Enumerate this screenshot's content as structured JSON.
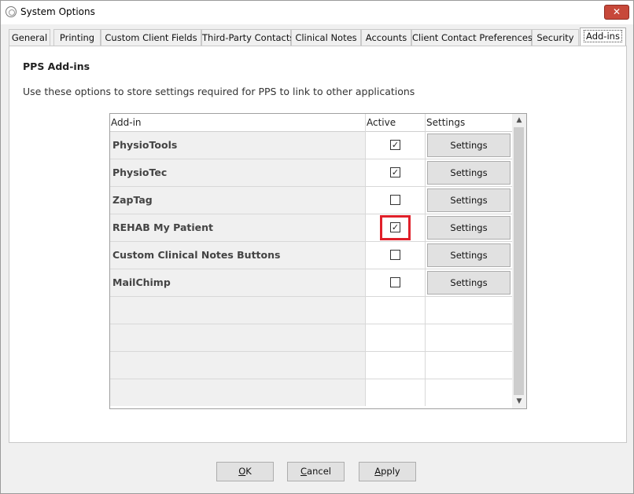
{
  "window": {
    "title": "System Options",
    "close_label": "✕"
  },
  "tabs": [
    {
      "label": "General"
    },
    {
      "label": "Printing"
    },
    {
      "label": "Custom Client Fields"
    },
    {
      "label": "Third-Party Contacts"
    },
    {
      "label": "Clinical Notes"
    },
    {
      "label": "Accounts"
    },
    {
      "label": "Client Contact Preferences"
    },
    {
      "label": "Security"
    },
    {
      "label": "Add-ins",
      "selected": true
    }
  ],
  "section": {
    "title": "PPS Add-ins",
    "description": "Use these options to store settings required for PPS to link to other applications"
  },
  "grid": {
    "columns": [
      "Add-in",
      "Active",
      "Settings"
    ],
    "rows": [
      {
        "name": "PhysioTools",
        "active": true,
        "active_mark": "✓",
        "settings_label": "Settings"
      },
      {
        "name": "PhysioTec",
        "active": true,
        "active_mark": "✓",
        "settings_label": "Settings"
      },
      {
        "name": "ZapTag",
        "active": false,
        "active_mark": "",
        "settings_label": "Settings"
      },
      {
        "name": "REHAB My Patient",
        "active": true,
        "active_mark": "✓",
        "settings_label": "Settings",
        "highlighted": true
      },
      {
        "name": "Custom Clinical Notes Buttons",
        "active": false,
        "active_mark": "",
        "settings_label": "Settings"
      },
      {
        "name": "MailChimp",
        "active": false,
        "active_mark": "",
        "settings_label": "Settings"
      }
    ],
    "scroll_up": "▲",
    "scroll_down": "▼"
  },
  "footer": {
    "ok": {
      "mnemonic": "O",
      "rest": "K"
    },
    "cancel": {
      "mnemonic": "C",
      "rest": "ancel"
    },
    "apply": {
      "mnemonic": "A",
      "rest": "pply"
    }
  },
  "colors": {
    "highlight": "#e0202a",
    "close_button": "#c7483a"
  }
}
